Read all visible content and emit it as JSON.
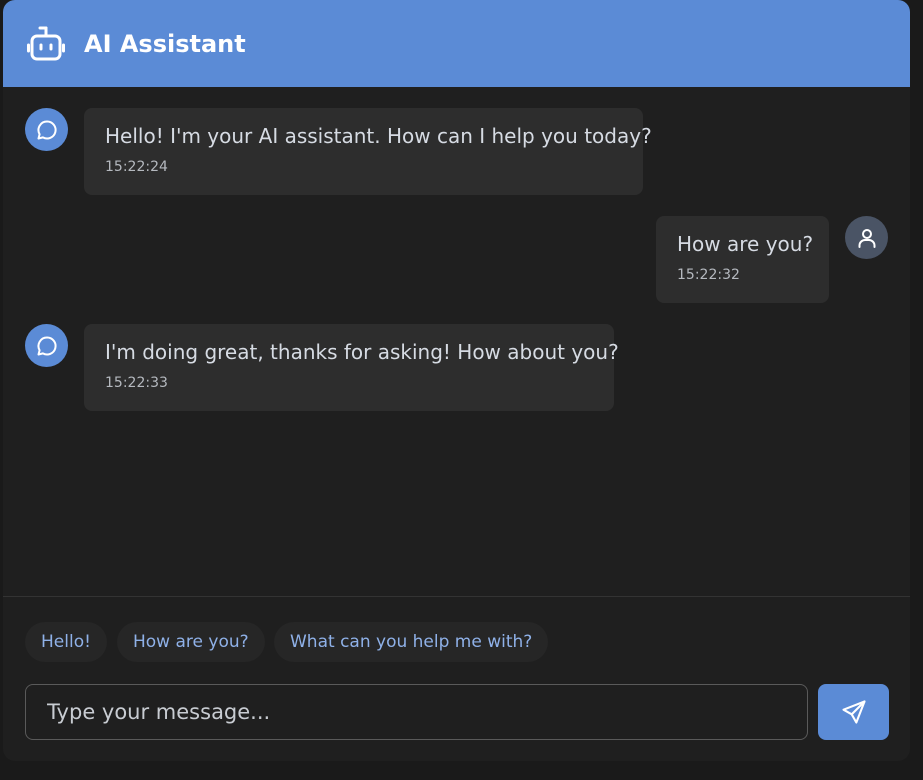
{
  "header": {
    "title": "AI Assistant",
    "icon": "robot-icon",
    "color": "#5b8bd6"
  },
  "messages": [
    {
      "sender": "bot",
      "text": "Hello! I'm your AI assistant. How can I help you today?",
      "time": "15:22:24"
    },
    {
      "sender": "user",
      "text": "How are you?",
      "time": "15:22:32"
    },
    {
      "sender": "bot",
      "text": "I'm doing great, thanks for asking! How about you?",
      "time": "15:22:33"
    }
  ],
  "suggestions": [
    "Hello!",
    "How are you?",
    "What can you help me with?"
  ],
  "composer": {
    "placeholder": "Type your message...",
    "value": "",
    "send_icon": "send-icon"
  },
  "colors": {
    "accent": "#5b8bd6",
    "background": "#1f1f1f",
    "bubble": "#2d2d2d",
    "user_avatar": "#4a5465",
    "suggestion_text": "#8fb1e8"
  }
}
